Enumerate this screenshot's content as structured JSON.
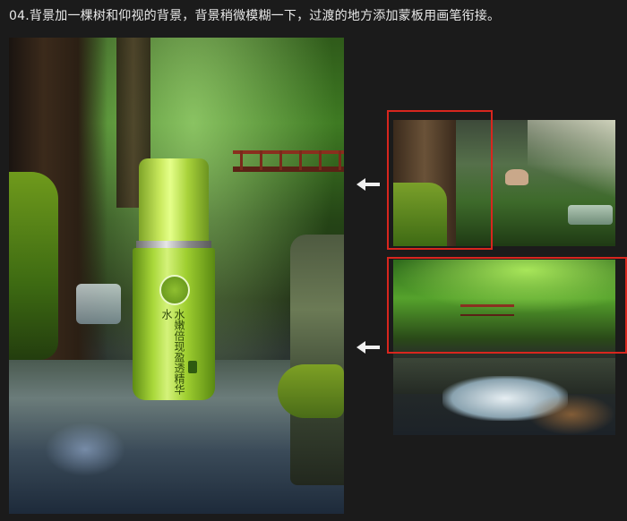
{
  "header": {
    "step_text": "04.背景加一棵树和仰视的背景，背景稍微模糊一下，过渡的地方添加蒙板用画笔衔接。"
  },
  "composite": {
    "product_label": "水嫩倍现盈透精华水"
  },
  "arrows": [
    "arrow-left-icon",
    "arrow-left-icon"
  ],
  "colors": {
    "background": "#1b1b1b",
    "selection": "#d8261e",
    "arrow": "#f0f0f0",
    "text": "#e8e8e8"
  }
}
